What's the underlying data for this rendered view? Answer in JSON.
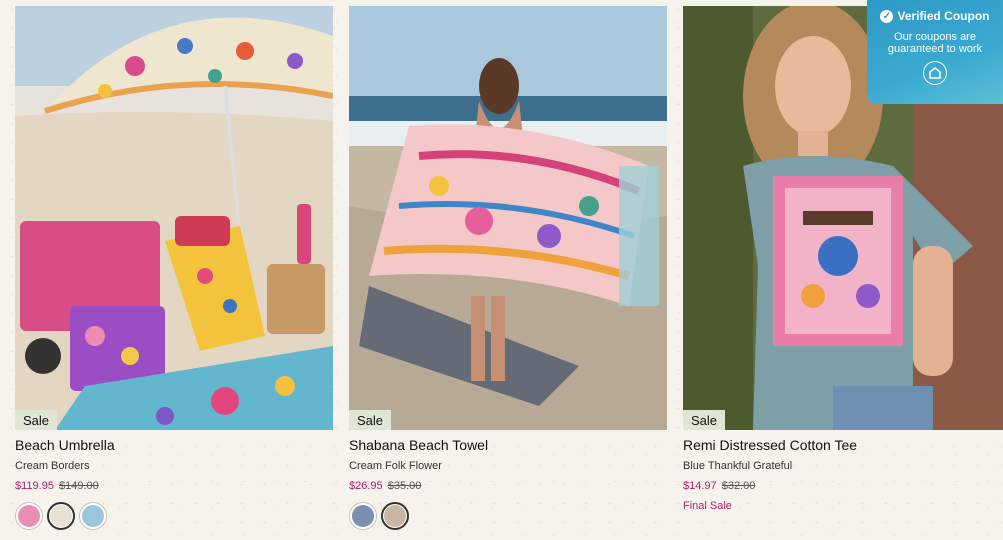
{
  "products": [
    {
      "badge": "Sale",
      "title": "Beach Umbrella",
      "variant": "Cream Borders",
      "price_sale": "$119.95",
      "price_original": "$149.00",
      "swatch_colors": [
        "#e98fb3",
        "#e8e2d4",
        "#9cc6dd"
      ]
    },
    {
      "badge": "Sale",
      "title": "Shabana Beach Towel",
      "variant": "Cream Folk Flower",
      "price_sale": "$26.95",
      "price_original": "$35.00",
      "swatch_colors": [
        "#7b8fb0",
        "#c9b7a3"
      ]
    },
    {
      "badge": "Sale",
      "title": "Remi Distressed Cotton Tee",
      "variant": "Blue Thankful Grateful",
      "price_sale": "$14.97",
      "price_original": "$32.00",
      "note": "Final Sale"
    }
  ],
  "coupon": {
    "title": "Verified Coupon",
    "text": "Our coupons are guaranteed to work",
    "icon": "check-icon"
  },
  "colors": {
    "sale_price": "#b0206b",
    "badge_bg": "#dfe6d5",
    "coupon_bg": "#3aa9d1"
  }
}
